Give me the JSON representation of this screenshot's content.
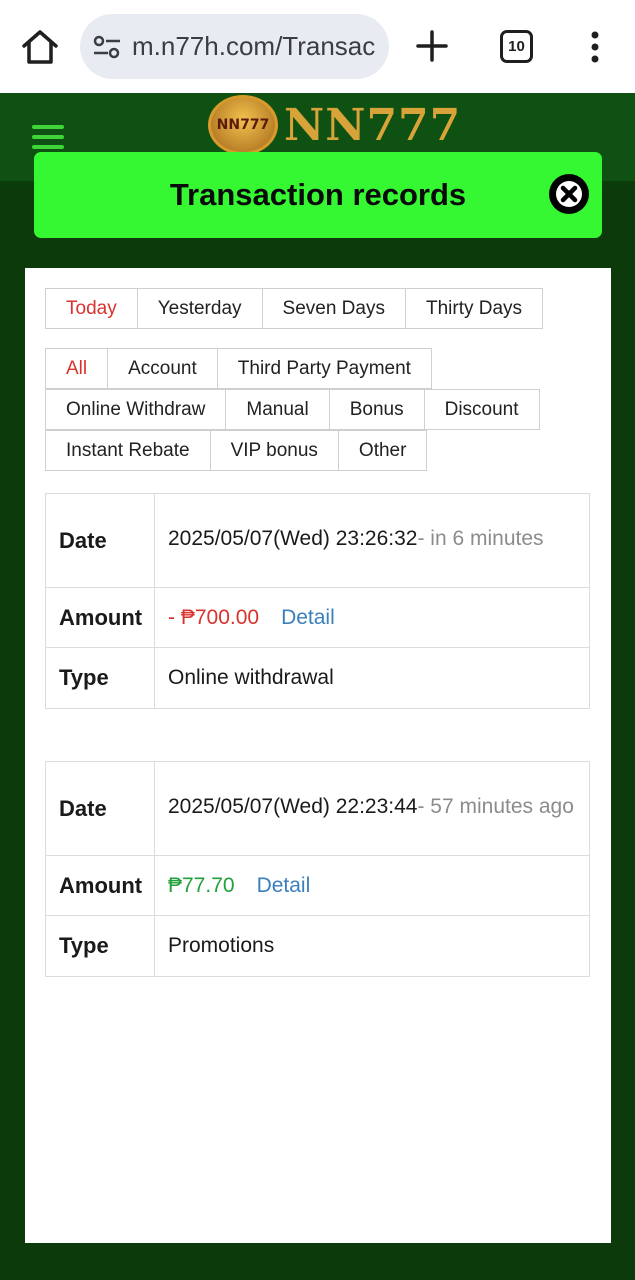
{
  "browser": {
    "url": "m.n77h.com/Transac",
    "tab_count": "10"
  },
  "site": {
    "logo_text": "NN777",
    "badge_text": "NN777"
  },
  "modal": {
    "title": "Transaction records"
  },
  "date_filters": [
    {
      "label": "Today",
      "active": true
    },
    {
      "label": "Yesterday",
      "active": false
    },
    {
      "label": "Seven Days",
      "active": false
    },
    {
      "label": "Thirty Days",
      "active": false
    }
  ],
  "type_filters": [
    {
      "label": "All",
      "active": true
    },
    {
      "label": "Account",
      "active": false
    },
    {
      "label": "Third Party Payment",
      "active": false
    },
    {
      "label": "Online Withdraw",
      "active": false
    },
    {
      "label": "Manual",
      "active": false
    },
    {
      "label": "Bonus",
      "active": false
    },
    {
      "label": "Discount",
      "active": false
    },
    {
      "label": "Instant Rebate",
      "active": false
    },
    {
      "label": "VIP bonus",
      "active": false
    },
    {
      "label": "Other",
      "active": false
    }
  ],
  "labels": {
    "date": "Date",
    "amount": "Amount",
    "type": "Type",
    "detail": "Detail"
  },
  "records": [
    {
      "date": "2025/05/07(Wed) 23:26:32",
      "relative": "- in 6 minutes",
      "amount": "- ₱700.00",
      "amount_color": "#d9332f",
      "type": "Online withdrawal"
    },
    {
      "date": "2025/05/07(Wed) 22:23:44",
      "relative": "- 57 minutes ago",
      "amount": "₱77.70",
      "amount_color": "#22a03a",
      "type": "Promotions"
    }
  ]
}
